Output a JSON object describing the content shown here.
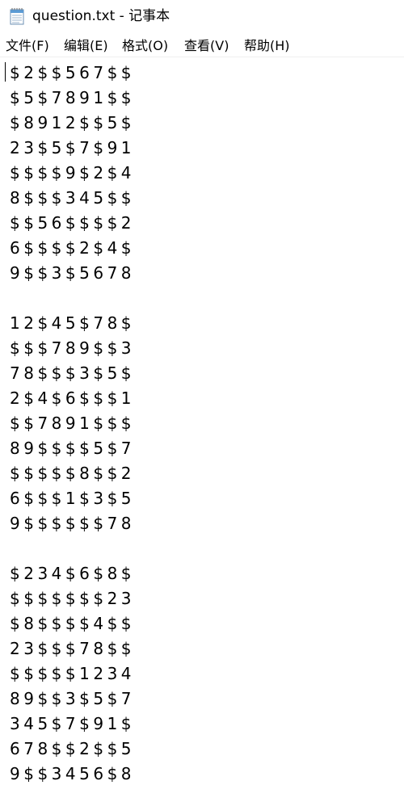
{
  "window": {
    "title": "question.txt - 记事本",
    "icon": "notepad-icon"
  },
  "menu": [
    {
      "label": "文件(F)"
    },
    {
      "label": "编辑(E)"
    },
    {
      "label": "格式(O)"
    },
    {
      "label": "查看(V)"
    },
    {
      "label": "帮助(H)"
    }
  ],
  "editor": {
    "content": "$2$$567$$\n$5$7891$$\n$8912$$5$\n23$5$7$91\n$$$$9$2$4\n8$$$345$$\n$$56$$$$2\n6$$$$2$4$\n9$$3$5678\n\n12$45$78$\n$$$789$$3\n78$$$3$5$\n2$4$6$$$1\n$$7891$$$\n89$$$$5$7\n$$$$$8$$2\n6$$$1$3$5\n9$$$$$$78\n\n$234$6$8$\n$$$$$$$23\n$8$$$$4$$\n23$$$78$$\n$$$$$1234\n89$$3$5$7\n345$7$91$\n678$$2$$5\n9$$3456$8"
  }
}
